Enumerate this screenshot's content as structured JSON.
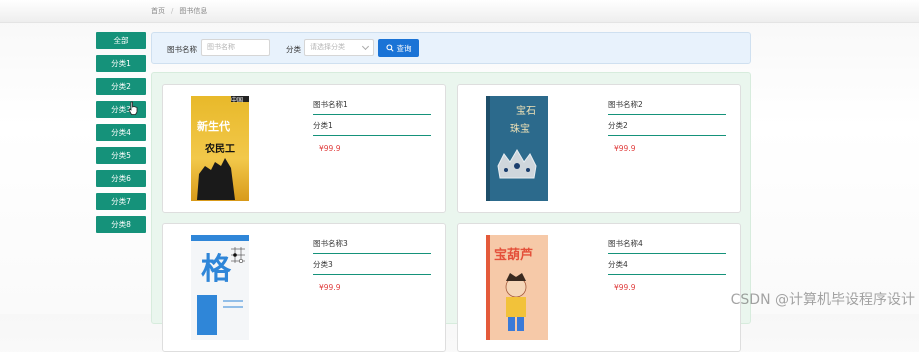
{
  "breadcrumb": {
    "home": "首页",
    "current": "图书信息"
  },
  "sidebar": {
    "items": [
      {
        "label": "全部"
      },
      {
        "label": "分类1"
      },
      {
        "label": "分类2"
      },
      {
        "label": "分类3"
      },
      {
        "label": "分类4"
      },
      {
        "label": "分类5"
      },
      {
        "label": "分类6"
      },
      {
        "label": "分类7"
      },
      {
        "label": "分类8"
      }
    ]
  },
  "search": {
    "name_label": "图书名称",
    "name_placeholder": "图书名称",
    "category_label": "分类",
    "category_placeholder": "请选择分类",
    "query_button": "查询"
  },
  "books": [
    {
      "title": "图书名称1",
      "category": "分类1",
      "price": "¥99.9",
      "cover": {
        "lines": [
          "新生代",
          "农民工"
        ],
        "top_text": "中国"
      }
    },
    {
      "title": "图书名称2",
      "category": "分类2",
      "price": "¥99.9",
      "cover": {
        "lines": [
          "宝石",
          "珠宝"
        ]
      }
    },
    {
      "title": "图书名称3",
      "category": "分类3",
      "price": "¥99.9",
      "cover": {
        "lines": [
          "格"
        ]
      }
    },
    {
      "title": "图书名称4",
      "category": "分类4",
      "price": "¥99.9",
      "cover": {
        "lines": [
          "宝葫芦"
        ]
      }
    }
  ],
  "watermark": "CSDN @计算机毕设程序设计",
  "colors": {
    "accent_green": "#15927a",
    "query_blue": "#1a73d6",
    "price_red": "#e03e3e"
  }
}
